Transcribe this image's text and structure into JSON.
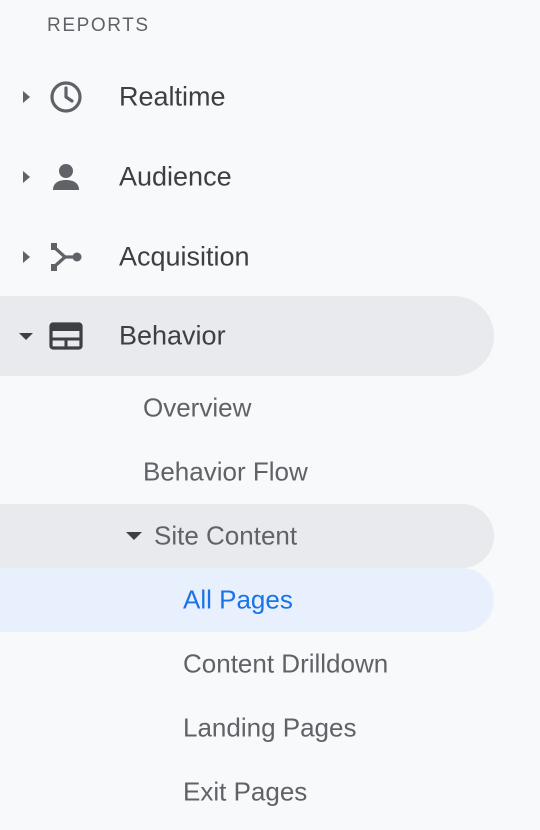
{
  "section": {
    "title": "REPORTS"
  },
  "nav": {
    "items": [
      {
        "label": "Realtime",
        "icon": "clock-icon",
        "expanded": false
      },
      {
        "label": "Audience",
        "icon": "person-icon",
        "expanded": false
      },
      {
        "label": "Acquisition",
        "icon": "merge-icon",
        "expanded": false
      },
      {
        "label": "Behavior",
        "icon": "browser-window-icon",
        "expanded": true
      }
    ],
    "behavior_children": [
      {
        "label": "Overview"
      },
      {
        "label": "Behavior Flow"
      },
      {
        "label": "Site Content",
        "expanded": true
      }
    ],
    "site_content_children": [
      {
        "label": "All Pages",
        "selected": true
      },
      {
        "label": "Content Drilldown"
      },
      {
        "label": "Landing Pages"
      },
      {
        "label": "Exit Pages"
      }
    ]
  },
  "colors": {
    "background": "#f8f9fa",
    "group_highlight": "#e8eaed",
    "selected_bg": "#e8f0fe",
    "selected_text": "#1a73e8",
    "text_primary": "#3c4043",
    "text_secondary": "#5f6368"
  }
}
